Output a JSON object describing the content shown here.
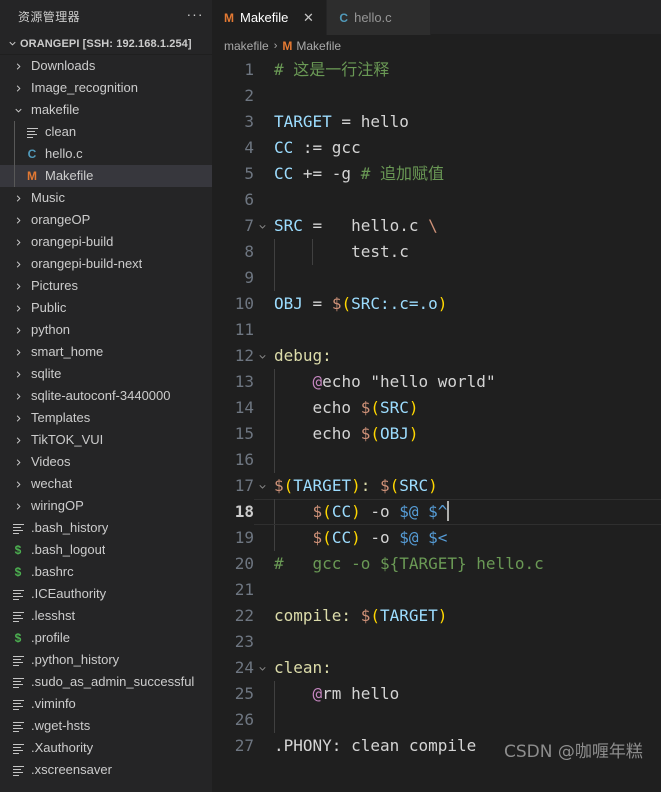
{
  "sidebar": {
    "title": "资源管理器",
    "more_label": "···",
    "root_label": "ORANGEPI [SSH: 192.168.1.254]",
    "items": [
      {
        "label": "Downloads",
        "icon": "chevron-right-icon",
        "type": "folder",
        "depth": 1
      },
      {
        "label": "Image_recognition",
        "icon": "chevron-right-icon",
        "type": "folder",
        "depth": 1
      },
      {
        "label": "makefile",
        "icon": "chevron-down-icon",
        "type": "folder",
        "depth": 1
      },
      {
        "label": "clean",
        "icon": "lines-file-icon",
        "type": "file",
        "depth": 2
      },
      {
        "label": "hello.c",
        "icon": "c-file-icon",
        "type": "file",
        "depth": 2
      },
      {
        "label": "Makefile",
        "icon": "makefile-icon",
        "type": "file",
        "depth": 2,
        "selected": true
      },
      {
        "label": "Music",
        "icon": "chevron-right-icon",
        "type": "folder",
        "depth": 1
      },
      {
        "label": "orangeOP",
        "icon": "chevron-right-icon",
        "type": "folder",
        "depth": 1
      },
      {
        "label": "orangepi-build",
        "icon": "chevron-right-icon",
        "type": "folder",
        "depth": 1
      },
      {
        "label": "orangepi-build-next",
        "icon": "chevron-right-icon",
        "type": "folder",
        "depth": 1
      },
      {
        "label": "Pictures",
        "icon": "chevron-right-icon",
        "type": "folder",
        "depth": 1
      },
      {
        "label": "Public",
        "icon": "chevron-right-icon",
        "type": "folder",
        "depth": 1
      },
      {
        "label": "python",
        "icon": "chevron-right-icon",
        "type": "folder",
        "depth": 1
      },
      {
        "label": "smart_home",
        "icon": "chevron-right-icon",
        "type": "folder",
        "depth": 1
      },
      {
        "label": "sqlite",
        "icon": "chevron-right-icon",
        "type": "folder",
        "depth": 1
      },
      {
        "label": "sqlite-autoconf-3440000",
        "icon": "chevron-right-icon",
        "type": "folder",
        "depth": 1
      },
      {
        "label": "Templates",
        "icon": "chevron-right-icon",
        "type": "folder",
        "depth": 1
      },
      {
        "label": "TikTOK_VUI",
        "icon": "chevron-right-icon",
        "type": "folder",
        "depth": 1
      },
      {
        "label": "Videos",
        "icon": "chevron-right-icon",
        "type": "folder",
        "depth": 1
      },
      {
        "label": "wechat",
        "icon": "chevron-right-icon",
        "type": "folder",
        "depth": 1
      },
      {
        "label": "wiringOP",
        "icon": "chevron-right-icon",
        "type": "folder",
        "depth": 1
      },
      {
        "label": ".bash_history",
        "icon": "lines-file-icon",
        "type": "file",
        "depth": 1
      },
      {
        "label": ".bash_logout",
        "icon": "shell-file-icon",
        "type": "file",
        "depth": 1
      },
      {
        "label": ".bashrc",
        "icon": "shell-file-icon",
        "type": "file",
        "depth": 1
      },
      {
        "label": ".ICEauthority",
        "icon": "lines-file-icon",
        "type": "file",
        "depth": 1
      },
      {
        "label": ".lesshst",
        "icon": "lines-file-icon",
        "type": "file",
        "depth": 1
      },
      {
        "label": ".profile",
        "icon": "shell-file-icon",
        "type": "file",
        "depth": 1
      },
      {
        "label": ".python_history",
        "icon": "lines-file-icon",
        "type": "file",
        "depth": 1
      },
      {
        "label": ".sudo_as_admin_successful",
        "icon": "lines-file-icon",
        "type": "file",
        "depth": 1
      },
      {
        "label": ".viminfo",
        "icon": "lines-file-icon",
        "type": "file",
        "depth": 1
      },
      {
        "label": ".wget-hsts",
        "icon": "lines-file-icon",
        "type": "file",
        "depth": 1
      },
      {
        "label": ".Xauthority",
        "icon": "lines-file-icon",
        "type": "file",
        "depth": 1
      },
      {
        "label": ".xscreensaver",
        "icon": "lines-file-icon",
        "type": "file",
        "depth": 1
      }
    ]
  },
  "tabs": [
    {
      "label": "Makefile",
      "icon": "makefile-icon",
      "icon_glyph": "M",
      "icon_color": "#e37933",
      "active": true,
      "close_glyph": "✕"
    },
    {
      "label": "hello.c",
      "icon": "c-file-icon",
      "icon_glyph": "C",
      "icon_color": "#519aba",
      "active": false,
      "close_glyph": ""
    }
  ],
  "breadcrumb": {
    "folder": "makefile",
    "separator": "›",
    "file": "Makefile",
    "file_icon_glyph": "M",
    "file_icon_color": "#e37933"
  },
  "editor": {
    "language": "makefile",
    "cursor_line": 18,
    "watermark": "CSDN @咖喱年糕",
    "colors": {
      "background": "#1f1f1f",
      "sidebar_background": "#252526",
      "selection": "#37373d",
      "comment": "#6a9955",
      "variable": "#9cdcfe",
      "target": "#dcdcaa",
      "dollar": "#ce9178",
      "paren": "#ffd700",
      "at": "#c586c0",
      "string": "#ce9178",
      "plain": "#d4d4d4",
      "linenum": "#6e7681",
      "caret": "#aeafad"
    },
    "lines": [
      {
        "n": 1,
        "fold": "",
        "indent_guides": 0,
        "tokens": [
          {
            "t": "# ",
            "c": "t-cmt"
          },
          {
            "t": "这是一行注释",
            "c": "t-cmt cjk"
          }
        ]
      },
      {
        "n": 2,
        "fold": "",
        "indent_guides": 0,
        "tokens": []
      },
      {
        "n": 3,
        "fold": "",
        "indent_guides": 0,
        "tokens": [
          {
            "t": "TARGET",
            "c": "t-var"
          },
          {
            "t": " = ",
            "c": "t-op"
          },
          {
            "t": "hello",
            "c": "t-txt"
          }
        ]
      },
      {
        "n": 4,
        "fold": "",
        "indent_guides": 0,
        "tokens": [
          {
            "t": "CC",
            "c": "t-var"
          },
          {
            "t": " := ",
            "c": "t-op"
          },
          {
            "t": "gcc",
            "c": "t-txt"
          }
        ]
      },
      {
        "n": 5,
        "fold": "",
        "indent_guides": 0,
        "tokens": [
          {
            "t": "CC",
            "c": "t-var"
          },
          {
            "t": " += ",
            "c": "t-op"
          },
          {
            "t": "-g ",
            "c": "t-txt"
          },
          {
            "t": "# ",
            "c": "t-cmt"
          },
          {
            "t": "追加赋值",
            "c": "t-cmt cjk"
          }
        ]
      },
      {
        "n": 6,
        "fold": "",
        "indent_guides": 0,
        "tokens": []
      },
      {
        "n": 7,
        "fold": "▾",
        "indent_guides": 0,
        "tokens": [
          {
            "t": "SRC",
            "c": "t-var"
          },
          {
            "t": " =   ",
            "c": "t-op"
          },
          {
            "t": "hello.c ",
            "c": "t-txt"
          },
          {
            "t": "\\",
            "c": "t-dol"
          }
        ]
      },
      {
        "n": 8,
        "fold": "",
        "indent_guides": 2,
        "tokens": [
          {
            "t": "        test.c",
            "c": "t-txt"
          }
        ]
      },
      {
        "n": 9,
        "fold": "",
        "indent_guides": 1,
        "tokens": []
      },
      {
        "n": 10,
        "fold": "",
        "indent_guides": 0,
        "tokens": [
          {
            "t": "OBJ",
            "c": "t-var"
          },
          {
            "t": " = ",
            "c": "t-op"
          },
          {
            "t": "$",
            "c": "t-dol"
          },
          {
            "t": "(",
            "c": "t-par"
          },
          {
            "t": "SRC:.c=.o",
            "c": "t-var"
          },
          {
            "t": ")",
            "c": "t-par"
          }
        ]
      },
      {
        "n": 11,
        "fold": "",
        "indent_guides": 0,
        "tokens": []
      },
      {
        "n": 12,
        "fold": "▾",
        "indent_guides": 0,
        "tokens": [
          {
            "t": "debug:",
            "c": "t-fn"
          }
        ]
      },
      {
        "n": 13,
        "fold": "",
        "indent_guides": 1,
        "tokens": [
          {
            "t": "    ",
            "c": "t-txt"
          },
          {
            "t": "@",
            "c": "t-at"
          },
          {
            "t": "echo ",
            "c": "t-txt"
          },
          {
            "t": "\"hello world\"",
            "c": "t-txt"
          }
        ]
      },
      {
        "n": 14,
        "fold": "",
        "indent_guides": 1,
        "tokens": [
          {
            "t": "    echo ",
            "c": "t-txt"
          },
          {
            "t": "$",
            "c": "t-dol"
          },
          {
            "t": "(",
            "c": "t-par"
          },
          {
            "t": "SRC",
            "c": "t-var"
          },
          {
            "t": ")",
            "c": "t-par"
          }
        ]
      },
      {
        "n": 15,
        "fold": "",
        "indent_guides": 1,
        "tokens": [
          {
            "t": "    echo ",
            "c": "t-txt"
          },
          {
            "t": "$",
            "c": "t-dol"
          },
          {
            "t": "(",
            "c": "t-par"
          },
          {
            "t": "OBJ",
            "c": "t-var"
          },
          {
            "t": ")",
            "c": "t-par"
          }
        ]
      },
      {
        "n": 16,
        "fold": "",
        "indent_guides": 1,
        "tokens": []
      },
      {
        "n": 17,
        "fold": "▾",
        "indent_guides": 0,
        "tokens": [
          {
            "t": "$",
            "c": "t-dol"
          },
          {
            "t": "(",
            "c": "t-par"
          },
          {
            "t": "TARGET",
            "c": "t-var"
          },
          {
            "t": ")",
            "c": "t-par"
          },
          {
            "t": ": ",
            "c": "t-fn"
          },
          {
            "t": "$",
            "c": "t-dol"
          },
          {
            "t": "(",
            "c": "t-par"
          },
          {
            "t": "SRC",
            "c": "t-var"
          },
          {
            "t": ")",
            "c": "t-par"
          }
        ]
      },
      {
        "n": 18,
        "fold": "",
        "indent_guides": 1,
        "current": true,
        "caret": true,
        "tokens": [
          {
            "t": "    ",
            "c": "t-txt"
          },
          {
            "t": "$",
            "c": "t-dol"
          },
          {
            "t": "(",
            "c": "t-par"
          },
          {
            "t": "CC",
            "c": "t-var"
          },
          {
            "t": ")",
            "c": "t-par"
          },
          {
            "t": " -o ",
            "c": "t-txt"
          },
          {
            "t": "$@ $^",
            "c": "t-kw"
          }
        ]
      },
      {
        "n": 19,
        "fold": "",
        "indent_guides": 1,
        "tokens": [
          {
            "t": "    ",
            "c": "t-txt"
          },
          {
            "t": "$",
            "c": "t-dol"
          },
          {
            "t": "(",
            "c": "t-par"
          },
          {
            "t": "CC",
            "c": "t-var"
          },
          {
            "t": ")",
            "c": "t-par"
          },
          {
            "t": " -o ",
            "c": "t-txt"
          },
          {
            "t": "$@ $<",
            "c": "t-kw"
          }
        ]
      },
      {
        "n": 20,
        "fold": "",
        "indent_guides": 0,
        "tokens": [
          {
            "t": "#   gcc -o ${TARGET} hello.c",
            "c": "t-cmt"
          }
        ]
      },
      {
        "n": 21,
        "fold": "",
        "indent_guides": 0,
        "tokens": []
      },
      {
        "n": 22,
        "fold": "",
        "indent_guides": 0,
        "tokens": [
          {
            "t": "compile: ",
            "c": "t-fn"
          },
          {
            "t": "$",
            "c": "t-dol"
          },
          {
            "t": "(",
            "c": "t-par"
          },
          {
            "t": "TARGET",
            "c": "t-var"
          },
          {
            "t": ")",
            "c": "t-par"
          }
        ]
      },
      {
        "n": 23,
        "fold": "",
        "indent_guides": 0,
        "tokens": []
      },
      {
        "n": 24,
        "fold": "▾",
        "indent_guides": 0,
        "tokens": [
          {
            "t": "clean:",
            "c": "t-fn"
          }
        ]
      },
      {
        "n": 25,
        "fold": "",
        "indent_guides": 1,
        "tokens": [
          {
            "t": "    ",
            "c": "t-txt"
          },
          {
            "t": "@",
            "c": "t-at"
          },
          {
            "t": "rm hello",
            "c": "t-txt"
          }
        ]
      },
      {
        "n": 26,
        "fold": "",
        "indent_guides": 1,
        "tokens": []
      },
      {
        "n": 27,
        "fold": "",
        "indent_guides": 0,
        "tokens": [
          {
            "t": ".PHONY: clean compile",
            "c": "t-txt"
          }
        ]
      }
    ]
  }
}
